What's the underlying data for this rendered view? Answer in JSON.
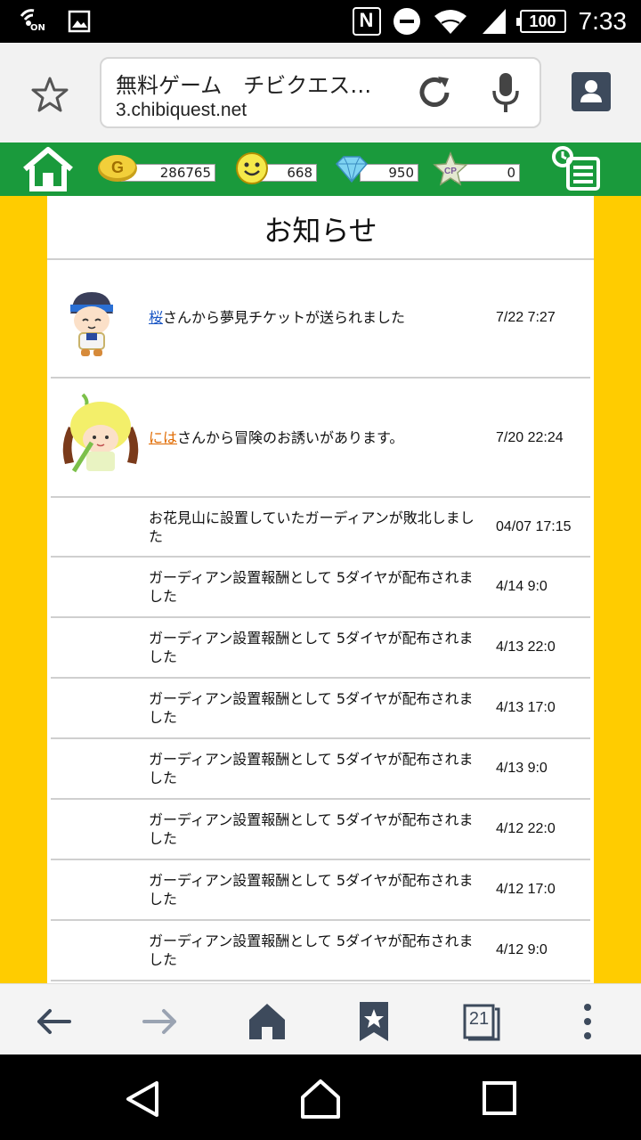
{
  "status_bar": {
    "time": "7:33",
    "battery": "100",
    "nfc_label": "N",
    "on_label": "ON"
  },
  "browser": {
    "page_title": "無料ゲーム　チビクエス…",
    "host": "3.chibiquest.net"
  },
  "game_header": {
    "gold": "286765",
    "smile": "668",
    "diamond": "950",
    "cp": "0",
    "gold_icon_letter": "G",
    "cp_icon_label": "CP"
  },
  "panel": {
    "title": "お知らせ"
  },
  "notifications": [
    {
      "sender": "桜",
      "message": "さんから夢見チケットが送られました",
      "time": "7/22 7:27"
    },
    {
      "sender": "には",
      "message": "さんから冒険のお誘いがあります。",
      "time": "7/20 22:24"
    },
    {
      "message": "お花見山に設置していたガーディアンが敗北しました",
      "time": "04/07 17:15"
    },
    {
      "message": "ガーディアン設置報酬として 5ダイヤが配布されました",
      "time": "4/14 9:0"
    },
    {
      "message": "ガーディアン設置報酬として 5ダイヤが配布されました",
      "time": "4/13 22:0"
    },
    {
      "message": "ガーディアン設置報酬として 5ダイヤが配布されました",
      "time": "4/13 17:0"
    },
    {
      "message": "ガーディアン設置報酬として 5ダイヤが配布されました",
      "time": "4/13 9:0"
    },
    {
      "message": "ガーディアン設置報酬として 5ダイヤが配布されました",
      "time": "4/12 22:0"
    },
    {
      "message": "ガーディアン設置報酬として 5ダイヤが配布されました",
      "time": "4/12 17:0"
    },
    {
      "message": "ガーディアン設置報酬として 5ダイヤが配布されました",
      "time": "4/12 9:0"
    }
  ],
  "bottom_nav": {
    "tab_count": "21"
  },
  "colors": {
    "game_green": "#1a9a3c",
    "side_yellow": "#ffcc00",
    "nav_icon": "#3d4a5c"
  },
  "icons": [
    "wifi-calling-icon",
    "image-icon",
    "nfc-icon",
    "dnd-icon",
    "wifi-icon",
    "signal-icon",
    "battery-icon",
    "bookmark-star-icon",
    "reload-icon",
    "mic-icon",
    "profile-icon",
    "home-icon",
    "gold-coin-icon",
    "smile-icon",
    "diamond-icon",
    "cp-star-icon",
    "menu-list-icon",
    "back-arrow-icon",
    "forward-arrow-icon",
    "home-nav-icon",
    "bookmarks-icon",
    "tabs-icon",
    "more-icon",
    "android-back-icon",
    "android-home-icon",
    "android-recents-icon"
  ]
}
